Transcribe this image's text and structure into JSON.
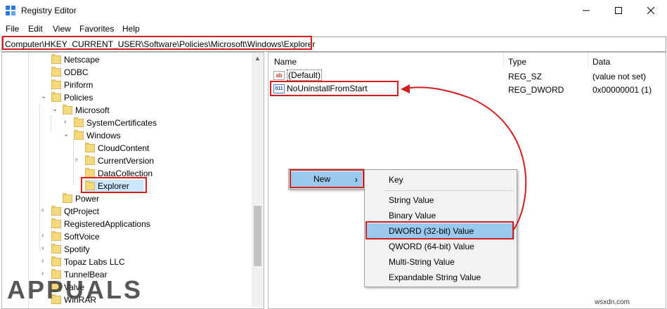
{
  "window": {
    "title": "Registry Editor",
    "minimize_glyph": "—",
    "maximize_glyph": "☐",
    "close_glyph": "✕"
  },
  "menu": [
    "File",
    "Edit",
    "View",
    "Favorites",
    "Help"
  ],
  "address": "Computer\\HKEY_CURRENT_USER\\Software\\Policies\\Microsoft\\Windows\\Explorer",
  "tree": [
    {
      "label": "Netscape",
      "expanded": false
    },
    {
      "label": "ODBC",
      "expanded": false
    },
    {
      "label": "Piriform",
      "expanded": false
    },
    {
      "label": "Policies",
      "expanded": true
    },
    {
      "label": "Microsoft",
      "expanded": true
    },
    {
      "label": "SystemCertificates",
      "expanded": false
    },
    {
      "label": "Windows",
      "expanded": true
    },
    {
      "label": "CloudContent",
      "expanded": false
    },
    {
      "label": "CurrentVersion",
      "expanded": false
    },
    {
      "label": "DataCollection",
      "expanded": false
    },
    {
      "label": "Explorer",
      "selected": true
    },
    {
      "label": "Power",
      "expanded": false
    },
    {
      "label": "QtProject",
      "expanded": false
    },
    {
      "label": "RegisteredApplications",
      "expanded": false
    },
    {
      "label": "SoftVoice",
      "expanded": false
    },
    {
      "label": "Spotify",
      "expanded": false
    },
    {
      "label": "Topaz Labs LLC",
      "expanded": false
    },
    {
      "label": "TunnelBear",
      "expanded": false
    },
    {
      "label": "Valve",
      "expanded": false
    },
    {
      "label": "WinRAR",
      "expanded": false
    }
  ],
  "columns": {
    "name": "Name",
    "type": "Type",
    "data": "Data"
  },
  "values": [
    {
      "name": "(Default)",
      "type": "REG_SZ",
      "data": "(value not set)",
      "icon": "ab"
    },
    {
      "name": "NoUninstallFromStart",
      "type": "REG_DWORD",
      "data": "0x00000001 (1)",
      "icon": "011"
    }
  ],
  "context_menu": {
    "label": "New",
    "arrow": "›"
  },
  "submenu": [
    {
      "label": "Key"
    },
    {
      "label": "String Value"
    },
    {
      "label": "Binary Value"
    },
    {
      "label": "DWORD (32-bit) Value",
      "highlighted": true
    },
    {
      "label": "QWORD (64-bit) Value"
    },
    {
      "label": "Multi-String Value"
    },
    {
      "label": "Expandable String Value"
    }
  ],
  "watermark": "APPUALS",
  "source": "wsxdn.com",
  "colors": {
    "annotation": "#d21e1e",
    "highlight": "#99c9ef",
    "selection": "#cce8ff"
  }
}
